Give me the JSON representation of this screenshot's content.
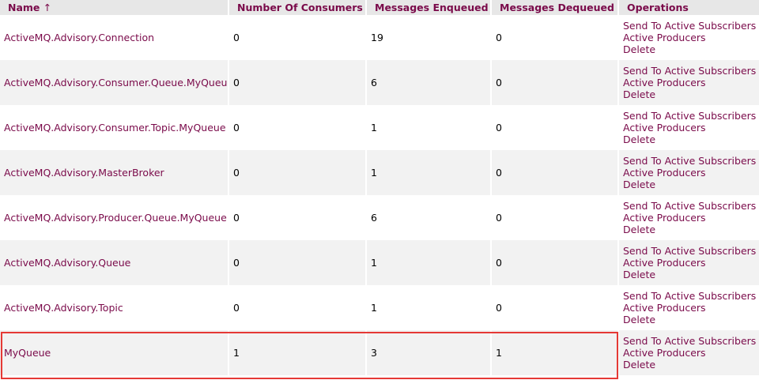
{
  "table": {
    "headers": {
      "name": "Name",
      "sort_arrow": "↑",
      "consumers": "Number Of Consumers",
      "enqueued": "Messages Enqueued",
      "dequeued": "Messages Dequeued",
      "operations": "Operations"
    },
    "operations": {
      "send": "Send To Active Subscribers",
      "producers": "Active Producers",
      "delete": "Delete"
    },
    "rows": [
      {
        "name": "ActiveMQ.Advisory.Connection",
        "consumers": "0",
        "enqueued": "19",
        "dequeued": "0"
      },
      {
        "name": "ActiveMQ.Advisory.Consumer.Queue.MyQueue",
        "consumers": "0",
        "enqueued": "6",
        "dequeued": "0"
      },
      {
        "name": "ActiveMQ.Advisory.Consumer.Topic.MyQueue",
        "consumers": "0",
        "enqueued": "1",
        "dequeued": "0"
      },
      {
        "name": "ActiveMQ.Advisory.MasterBroker",
        "consumers": "0",
        "enqueued": "1",
        "dequeued": "0"
      },
      {
        "name": "ActiveMQ.Advisory.Producer.Queue.MyQueue",
        "consumers": "0",
        "enqueued": "6",
        "dequeued": "0"
      },
      {
        "name": "ActiveMQ.Advisory.Queue",
        "consumers": "0",
        "enqueued": "1",
        "dequeued": "0"
      },
      {
        "name": "ActiveMQ.Advisory.Topic",
        "consumers": "0",
        "enqueued": "1",
        "dequeued": "0"
      },
      {
        "name": "MyQueue",
        "consumers": "1",
        "enqueued": "3",
        "dequeued": "1"
      }
    ]
  },
  "colors": {
    "link": "#7a0a4a",
    "header_bg": "#e7e7e7",
    "row_alt_bg": "#f2f2f2",
    "highlight_border": "#e53935"
  }
}
